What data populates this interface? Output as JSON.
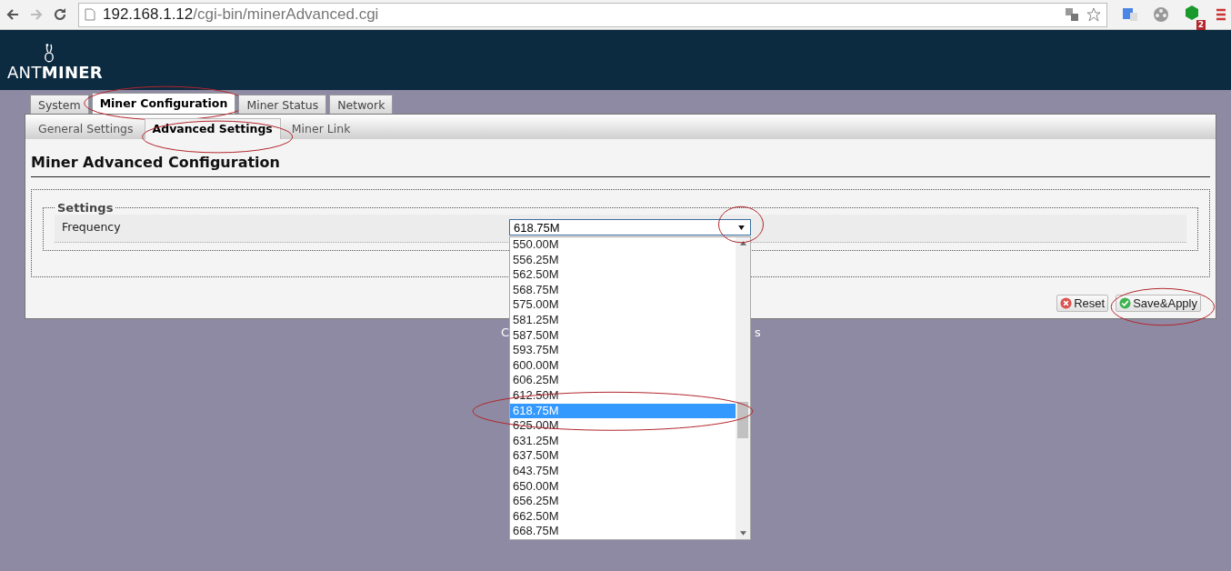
{
  "browser": {
    "url_host": "192.168.1.12",
    "url_path": "/cgi-bin/minerAdvanced.cgi",
    "extension_badge": "2"
  },
  "header": {
    "logo_light": "ANT",
    "logo_bold": "MINER"
  },
  "tabs": [
    {
      "label": "System",
      "selected": false,
      "circled": false
    },
    {
      "label": "Miner Configuration",
      "selected": true,
      "circled": true
    },
    {
      "label": "Miner Status",
      "selected": false,
      "circled": false
    },
    {
      "label": "Network",
      "selected": false,
      "circled": false
    }
  ],
  "subtabs": [
    {
      "label": "General Settings",
      "selected": false,
      "circled": false
    },
    {
      "label": "Advanced Settings",
      "selected": true,
      "circled": true
    },
    {
      "label": "Miner Link",
      "selected": false,
      "circled": false
    }
  ],
  "heading": "Miner Advanced Configuration",
  "settings": {
    "legend": "Settings",
    "fields": [
      {
        "label": "Frequency",
        "value": "618.75M",
        "open": true,
        "arrow_circled": true,
        "options": [
          {
            "label": "550.00M",
            "selected": false,
            "circled": false
          },
          {
            "label": "556.25M",
            "selected": false,
            "circled": false
          },
          {
            "label": "562.50M",
            "selected": false,
            "circled": false
          },
          {
            "label": "568.75M",
            "selected": false,
            "circled": false
          },
          {
            "label": "575.00M",
            "selected": false,
            "circled": false
          },
          {
            "label": "581.25M",
            "selected": false,
            "circled": false
          },
          {
            "label": "587.50M",
            "selected": false,
            "circled": false
          },
          {
            "label": "593.75M",
            "selected": false,
            "circled": false
          },
          {
            "label": "600.00M",
            "selected": false,
            "circled": false
          },
          {
            "label": "606.25M",
            "selected": false,
            "circled": false
          },
          {
            "label": "612.50M",
            "selected": false,
            "circled": false
          },
          {
            "label": "618.75M",
            "selected": true,
            "circled": true
          },
          {
            "label": "625.00M",
            "selected": false,
            "circled": false
          },
          {
            "label": "631.25M",
            "selected": false,
            "circled": false
          },
          {
            "label": "637.50M",
            "selected": false,
            "circled": false
          },
          {
            "label": "643.75M",
            "selected": false,
            "circled": false
          },
          {
            "label": "650.00M",
            "selected": false,
            "circled": false
          },
          {
            "label": "656.25M",
            "selected": false,
            "circled": false
          },
          {
            "label": "662.50M",
            "selected": false,
            "circled": false
          },
          {
            "label": "668.75M",
            "selected": false,
            "circled": false
          }
        ]
      }
    ]
  },
  "buttons": [
    {
      "kind": "reset",
      "label": "Reset",
      "circled": false
    },
    {
      "kind": "save",
      "label": "Save&Apply",
      "circled": true
    }
  ],
  "footer": {
    "left": "C",
    "right": "s"
  }
}
